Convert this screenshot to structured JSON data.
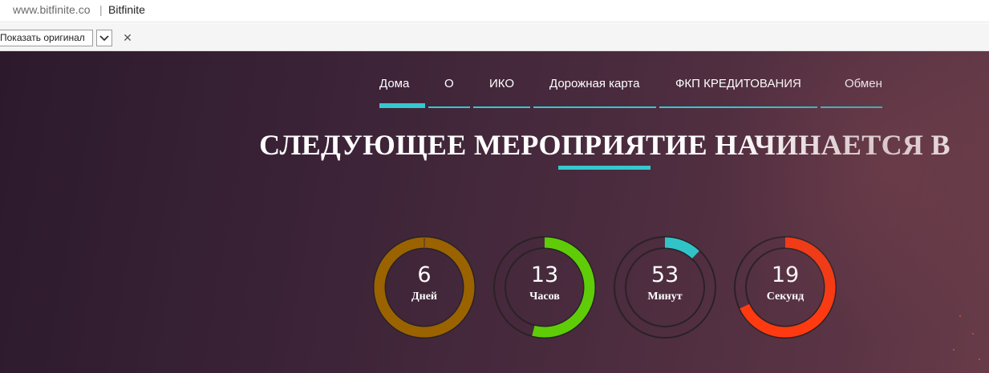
{
  "browser": {
    "url": "www.bitfinite.co",
    "separator": "|",
    "title": "Bitfinite"
  },
  "translate_bar": {
    "show_original_label": "Показать оригинал",
    "dropdown_icon": "chevron-down-icon",
    "close_icon": "close-icon",
    "close_glyph": "✕"
  },
  "nav": {
    "accent_color": "#35c8cf",
    "items": [
      {
        "label": "Дома",
        "active": true
      },
      {
        "label": "О",
        "active": false
      },
      {
        "label": "ИКО",
        "active": false
      },
      {
        "label": "Дорожная карта",
        "active": false
      },
      {
        "label": "ФКП КРЕДИТОВАНИЯ",
        "active": false
      },
      {
        "label": "Обмен",
        "active": false
      }
    ]
  },
  "headline": "СЛЕДУЮЩЕЕ МЕРОПРИЯТИЕ НАЧИНАЕТСЯ В",
  "countdown": [
    {
      "value": "6",
      "label": "Дней",
      "fraction": 1.0,
      "color": "#9a6300"
    },
    {
      "value": "13",
      "label": "Часов",
      "fraction": 0.54,
      "color": "#5fcc08"
    },
    {
      "value": "53",
      "label": "Минут",
      "fraction": 0.12,
      "color": "#30c4c8"
    },
    {
      "value": "19",
      "label": "Секунд",
      "fraction": 0.68,
      "color": "#ff3a10"
    }
  ]
}
